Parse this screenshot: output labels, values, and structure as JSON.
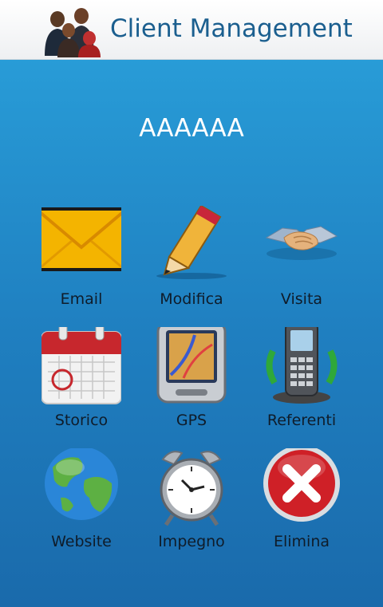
{
  "header": {
    "title": "Client Management",
    "logo_icon": "people-icon"
  },
  "client": {
    "name": "AAAAAA"
  },
  "actions": [
    {
      "label": "Email",
      "icon": "envelope-icon"
    },
    {
      "label": "Modifica",
      "icon": "pencil-icon"
    },
    {
      "label": "Visita",
      "icon": "handshake-icon"
    },
    {
      "label": "Storico",
      "icon": "calendar-icon"
    },
    {
      "label": "GPS",
      "icon": "gps-device-icon"
    },
    {
      "label": "Referenti",
      "icon": "phone-icon"
    },
    {
      "label": "Website",
      "icon": "globe-icon"
    },
    {
      "label": "Impegno",
      "icon": "alarm-clock-icon"
    },
    {
      "label": "Elimina",
      "icon": "delete-x-icon"
    }
  ],
  "colors": {
    "header_title": "#1b5f8f",
    "background_top": "#2aa2dc",
    "background_bottom": "#1a6aab"
  }
}
